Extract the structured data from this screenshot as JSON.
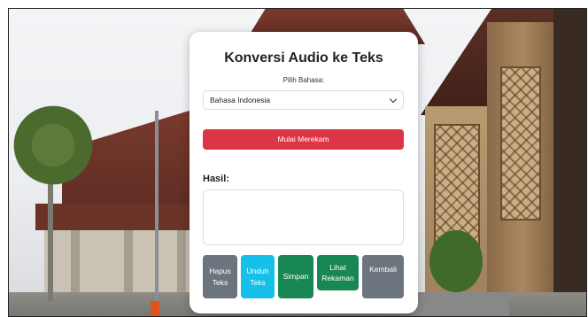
{
  "app": {
    "title": "Konversi Audio ke Teks"
  },
  "language": {
    "label": "Pilih Bahasa:",
    "selected": "Bahasa Indonesia"
  },
  "record": {
    "label": "Mulai Merekam"
  },
  "result": {
    "label": "Hasil:",
    "text": ""
  },
  "actions": {
    "hapus": "Hapus Teks",
    "unduh": "Unduh Teks",
    "simpan": "Simpan",
    "lihat": "Lihat Rekaman",
    "kembali": "Kembali"
  },
  "colors": {
    "record": "#dc3545",
    "gray": "#6c757d",
    "cyan": "#17c0e8",
    "green": "#198754"
  },
  "icons": {
    "select_chevron": "chevron-down-icon"
  }
}
